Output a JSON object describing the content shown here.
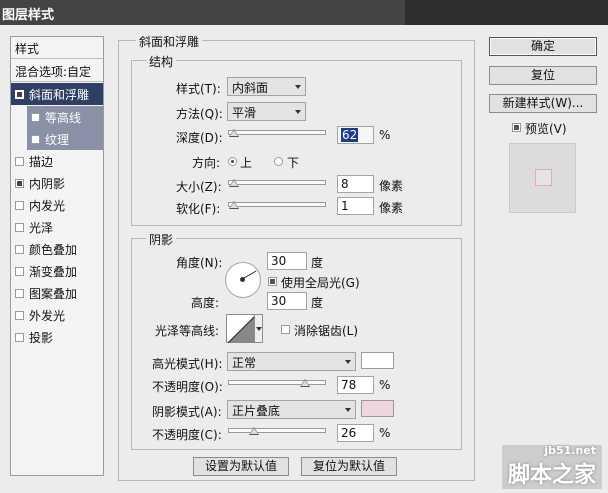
{
  "window": {
    "title": "图层样式"
  },
  "styles_panel": {
    "header": "样式",
    "blending_options": "混合选项:自定",
    "items": [
      {
        "label": "斜面和浮雕",
        "checked": true,
        "active": true
      },
      {
        "label": "等高线",
        "checked": false,
        "sub": true
      },
      {
        "label": "纹理",
        "checked": false,
        "sub": true
      },
      {
        "label": "描边",
        "checked": false
      },
      {
        "label": "内阴影",
        "checked": true
      },
      {
        "label": "内发光",
        "checked": false
      },
      {
        "label": "光泽",
        "checked": false
      },
      {
        "label": "颜色叠加",
        "checked": false
      },
      {
        "label": "渐变叠加",
        "checked": false
      },
      {
        "label": "图案叠加",
        "checked": false
      },
      {
        "label": "外发光",
        "checked": false
      },
      {
        "label": "投影",
        "checked": false
      }
    ]
  },
  "bevel": {
    "group_title": "斜面和浮雕",
    "structure_title": "结构",
    "style_label": "样式(T):",
    "style_value": "内斜面",
    "technique_label": "方法(Q):",
    "technique_value": "平滑",
    "depth_label": "深度(D):",
    "depth_value": "62",
    "depth_unit": "%",
    "direction_label": "方向:",
    "direction_up": "上",
    "direction_down": "下",
    "size_label": "大小(Z):",
    "size_value": "8",
    "size_unit": "像素",
    "soften_label": "软化(F):",
    "soften_value": "1",
    "soften_unit": "像素"
  },
  "shading": {
    "title": "阴影",
    "angle_label": "角度(N):",
    "angle_value": "30",
    "angle_unit": "度",
    "global_light_label": "使用全局光(G)",
    "altitude_label": "高度:",
    "altitude_value": "30",
    "altitude_unit": "度",
    "gloss_contour_label": "光泽等高线:",
    "antialias_label": "消除锯齿(L)",
    "highlight_mode_label": "高光模式(H):",
    "highlight_mode_value": "正常",
    "highlight_color": "#ffffff",
    "highlight_opacity_label": "不透明度(O):",
    "highlight_opacity_value": "78",
    "highlight_opacity_unit": "%",
    "shadow_mode_label": "阴影模式(A):",
    "shadow_mode_value": "正片叠底",
    "shadow_color": "#efd5dd",
    "shadow_opacity_label": "不透明度(C):",
    "shadow_opacity_value": "26",
    "shadow_opacity_unit": "%"
  },
  "footer": {
    "make_default": "设置为默认值",
    "reset_default": "复位为默认值"
  },
  "right": {
    "ok": "确定",
    "reset": "复位",
    "new_style": "新建样式(W)...",
    "preview_label": "预览(V)"
  },
  "watermark": {
    "site": "jb51.net",
    "text": "脚本之家"
  }
}
